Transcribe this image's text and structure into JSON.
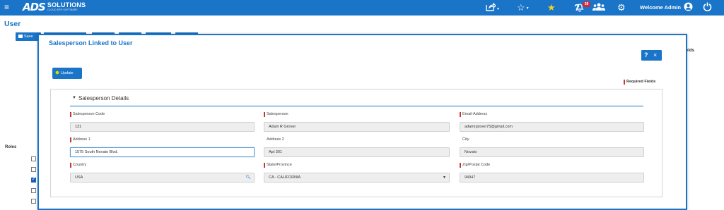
{
  "header": {
    "menu_icon": "hamburger-icon",
    "logo_mark": "ADS",
    "logo_brand": "SOLUTIONS",
    "logo_tag": "CLOUD ERP SOFTWARE",
    "notification_count": "38",
    "welcome": "Welcome Admin",
    "icons": [
      "share-icon",
      "star-outline-icon",
      "star-filled-icon",
      "help-icon",
      "bell-icon",
      "users-icon",
      "gear-icon",
      "user-circle-icon",
      "power-icon"
    ]
  },
  "page": {
    "title": "User",
    "save_label": "Save",
    "fields_label": "elds",
    "roles_label": "Roles",
    "role_checks": [
      false,
      false,
      true,
      false,
      false
    ]
  },
  "modal": {
    "title": "Salesperson Linked to User",
    "help_label": "?",
    "close_label": "×",
    "update_label": "Update",
    "required_note": "Required Fields",
    "section_title": "Salesperson Details",
    "fields": {
      "salesperson_code": {
        "label": "Salesperson Code",
        "value": "131"
      },
      "salesperson": {
        "label": "Salesperson",
        "value": "Adam R Grover"
      },
      "email": {
        "label": "Email Address",
        "value": "adamrgrover75@gmail.com"
      },
      "address1": {
        "label": "Address 1",
        "value": "1575 South Novato Blvd."
      },
      "address2": {
        "label": "Address 2",
        "value": "Apt 301"
      },
      "city": {
        "label": "City",
        "value": "Novato"
      },
      "country": {
        "label": "Country",
        "value": "USA"
      },
      "state": {
        "label": "State/Province",
        "value": "CA - CALIFORNIA"
      },
      "zip": {
        "label": "Zip/Postal Code",
        "value": "94947"
      }
    }
  },
  "colors": {
    "primary": "#1a74c8",
    "required_marker": "#c0392b",
    "badge": "#e4212c",
    "star": "#f3d21b"
  }
}
